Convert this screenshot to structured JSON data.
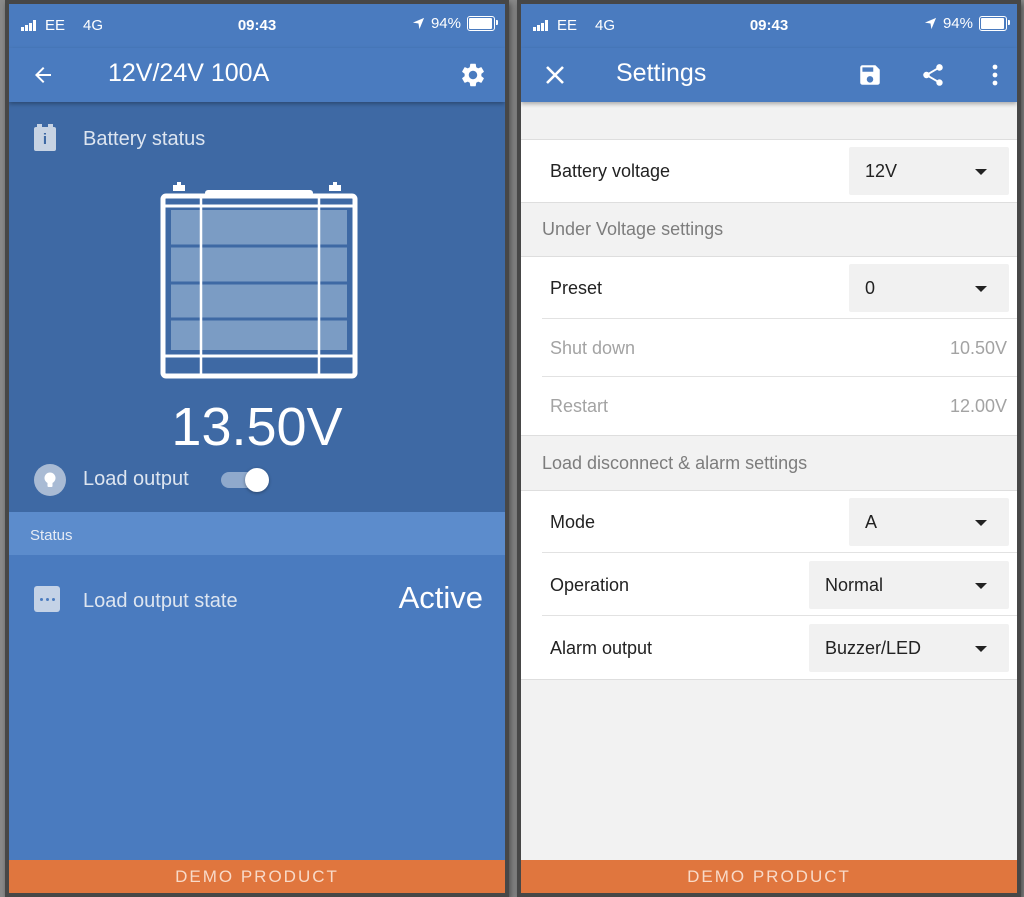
{
  "status_bar": {
    "carrier": "EE",
    "network": "4G",
    "time": "09:43",
    "battery_percent": "94%"
  },
  "left_screen": {
    "title": "12V/24V 100A",
    "battery_status_label": "Battery status",
    "voltage": "13.50V",
    "load_output_label": "Load output",
    "load_output_on": true,
    "status_section": "Status",
    "load_output_state_label": "Load output state",
    "load_output_state_value": "Active"
  },
  "right_screen": {
    "title": "Settings",
    "battery_voltage": {
      "label": "Battery voltage",
      "value": "12V"
    },
    "under_voltage_header": "Under Voltage settings",
    "preset": {
      "label": "Preset",
      "value": "0"
    },
    "shut_down": {
      "label": "Shut down",
      "value": "10.50V"
    },
    "restart": {
      "label": "Restart",
      "value": "12.00V"
    },
    "load_disconnect_header": "Load disconnect & alarm settings",
    "mode": {
      "label": "Mode",
      "value": "A"
    },
    "operation": {
      "label": "Operation",
      "value": "Normal"
    },
    "alarm_output": {
      "label": "Alarm output",
      "value": "Buzzer/LED"
    }
  },
  "demo_banner": "DEMO PRODUCT",
  "colors": {
    "app_blue": "#4a7bbf",
    "panel_blue": "#3e69a4",
    "section_blue": "#5c8ccc",
    "demo_orange": "#e0763e",
    "settings_bg": "#f2f2f2"
  }
}
